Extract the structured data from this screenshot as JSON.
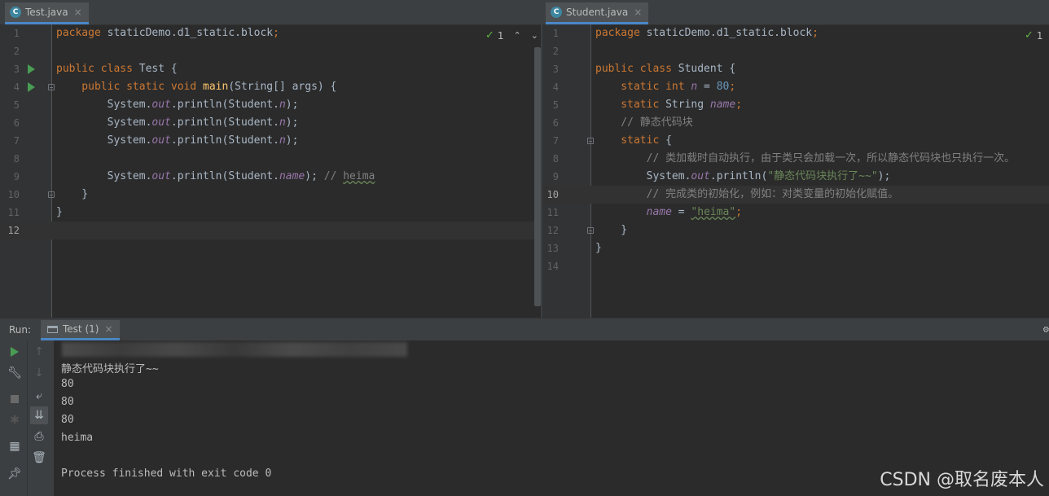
{
  "left_editor": {
    "tab": {
      "icon": "C",
      "name": "Test.java",
      "close": "×"
    },
    "inspection": {
      "count": "1"
    },
    "lines": [
      {
        "n": "1",
        "segs": [
          {
            "t": "package ",
            "c": "kw"
          },
          {
            "t": "staticDemo.d1_static.block",
            "c": ""
          },
          {
            "t": ";",
            "c": "kw"
          }
        ]
      },
      {
        "n": "2",
        "segs": []
      },
      {
        "n": "3",
        "segs": [
          {
            "t": "public class ",
            "c": "kw"
          },
          {
            "t": "Test {",
            "c": ""
          }
        ]
      },
      {
        "n": "4",
        "segs": [
          {
            "t": "    public static void ",
            "c": "kw"
          },
          {
            "t": "main",
            "c": "fn"
          },
          {
            "t": "(String[] args) {",
            "c": ""
          }
        ]
      },
      {
        "n": "5",
        "segs": [
          {
            "t": "        System.",
            "c": ""
          },
          {
            "t": "out",
            "c": "st"
          },
          {
            "t": ".println(Student.",
            "c": ""
          },
          {
            "t": "n",
            "c": "st"
          },
          {
            "t": ");",
            "c": ""
          }
        ]
      },
      {
        "n": "6",
        "segs": [
          {
            "t": "        System.",
            "c": ""
          },
          {
            "t": "out",
            "c": "st"
          },
          {
            "t": ".println(Student.",
            "c": ""
          },
          {
            "t": "n",
            "c": "st"
          },
          {
            "t": ");",
            "c": ""
          }
        ]
      },
      {
        "n": "7",
        "segs": [
          {
            "t": "        System.",
            "c": ""
          },
          {
            "t": "out",
            "c": "st"
          },
          {
            "t": ".println(Student.",
            "c": ""
          },
          {
            "t": "n",
            "c": "st"
          },
          {
            "t": ");",
            "c": ""
          }
        ]
      },
      {
        "n": "8",
        "segs": []
      },
      {
        "n": "9",
        "segs": [
          {
            "t": "        System.",
            "c": ""
          },
          {
            "t": "out",
            "c": "st"
          },
          {
            "t": ".println(Student.",
            "c": ""
          },
          {
            "t": "name",
            "c": "st"
          },
          {
            "t": "); ",
            "c": ""
          },
          {
            "t": "// ",
            "c": "cm"
          },
          {
            "t": "heima",
            "c": "cm wavy"
          }
        ]
      },
      {
        "n": "10",
        "segs": [
          {
            "t": "    }",
            "c": ""
          }
        ]
      },
      {
        "n": "11",
        "segs": [
          {
            "t": "}",
            "c": ""
          }
        ]
      },
      {
        "n": "12",
        "segs": []
      }
    ]
  },
  "right_editor": {
    "tab": {
      "icon": "C",
      "name": "Student.java",
      "close": "×"
    },
    "inspection": {
      "count": "1"
    },
    "lines": [
      {
        "n": "1",
        "segs": [
          {
            "t": "package ",
            "c": "kw"
          },
          {
            "t": "staticDemo.d1_static.block",
            "c": ""
          },
          {
            "t": ";",
            "c": "kw"
          }
        ]
      },
      {
        "n": "2",
        "segs": []
      },
      {
        "n": "3",
        "segs": [
          {
            "t": "public class ",
            "c": "kw"
          },
          {
            "t": "Student {",
            "c": ""
          }
        ]
      },
      {
        "n": "4",
        "segs": [
          {
            "t": "    static int ",
            "c": "kw"
          },
          {
            "t": "n",
            "c": "st"
          },
          {
            "t": " = ",
            "c": ""
          },
          {
            "t": "80",
            "c": "num"
          },
          {
            "t": ";",
            "c": "kw"
          }
        ]
      },
      {
        "n": "5",
        "segs": [
          {
            "t": "    static ",
            "c": "kw"
          },
          {
            "t": "String ",
            "c": ""
          },
          {
            "t": "name",
            "c": "st"
          },
          {
            "t": ";",
            "c": "kw"
          }
        ]
      },
      {
        "n": "6",
        "segs": [
          {
            "t": "    // 静态代码块",
            "c": "cm"
          }
        ]
      },
      {
        "n": "7",
        "segs": [
          {
            "t": "    static ",
            "c": "kw"
          },
          {
            "t": "{",
            "c": ""
          }
        ]
      },
      {
        "n": "8",
        "segs": [
          {
            "t": "        // 类加载时自动执行，由于类只会加载一次，所以静态代码块也只执行一次。",
            "c": "cm"
          }
        ]
      },
      {
        "n": "9",
        "segs": [
          {
            "t": "        System.",
            "c": ""
          },
          {
            "t": "out",
            "c": "st"
          },
          {
            "t": ".println(",
            "c": ""
          },
          {
            "t": "\"静态代码块执行了~~\"",
            "c": "str"
          },
          {
            "t": ");",
            "c": ""
          }
        ]
      },
      {
        "n": "10",
        "segs": [
          {
            "t": "        // 完成类的初始化，例如：对类变量的初始化赋值。",
            "c": "cm"
          }
        ]
      },
      {
        "n": "11",
        "segs": [
          {
            "t": "        ",
            "c": ""
          },
          {
            "t": "name",
            "c": "st"
          },
          {
            "t": " = ",
            "c": ""
          },
          {
            "t": "\"heima\"",
            "c": "str wavy"
          },
          {
            "t": ";",
            "c": "kw"
          }
        ]
      },
      {
        "n": "12",
        "segs": [
          {
            "t": "    }",
            "c": ""
          }
        ]
      },
      {
        "n": "13",
        "segs": [
          {
            "t": "}",
            "c": ""
          }
        ]
      },
      {
        "n": "14",
        "segs": []
      }
    ]
  },
  "run_panel": {
    "label": "Run:",
    "tab": {
      "name": "Test (1)",
      "close": "×"
    },
    "output": [
      "静态代码块执行了~~",
      "80",
      "80",
      "80",
      "heima",
      "",
      "Process finished with exit code 0"
    ]
  },
  "watermark": "CSDN @取名废本人"
}
